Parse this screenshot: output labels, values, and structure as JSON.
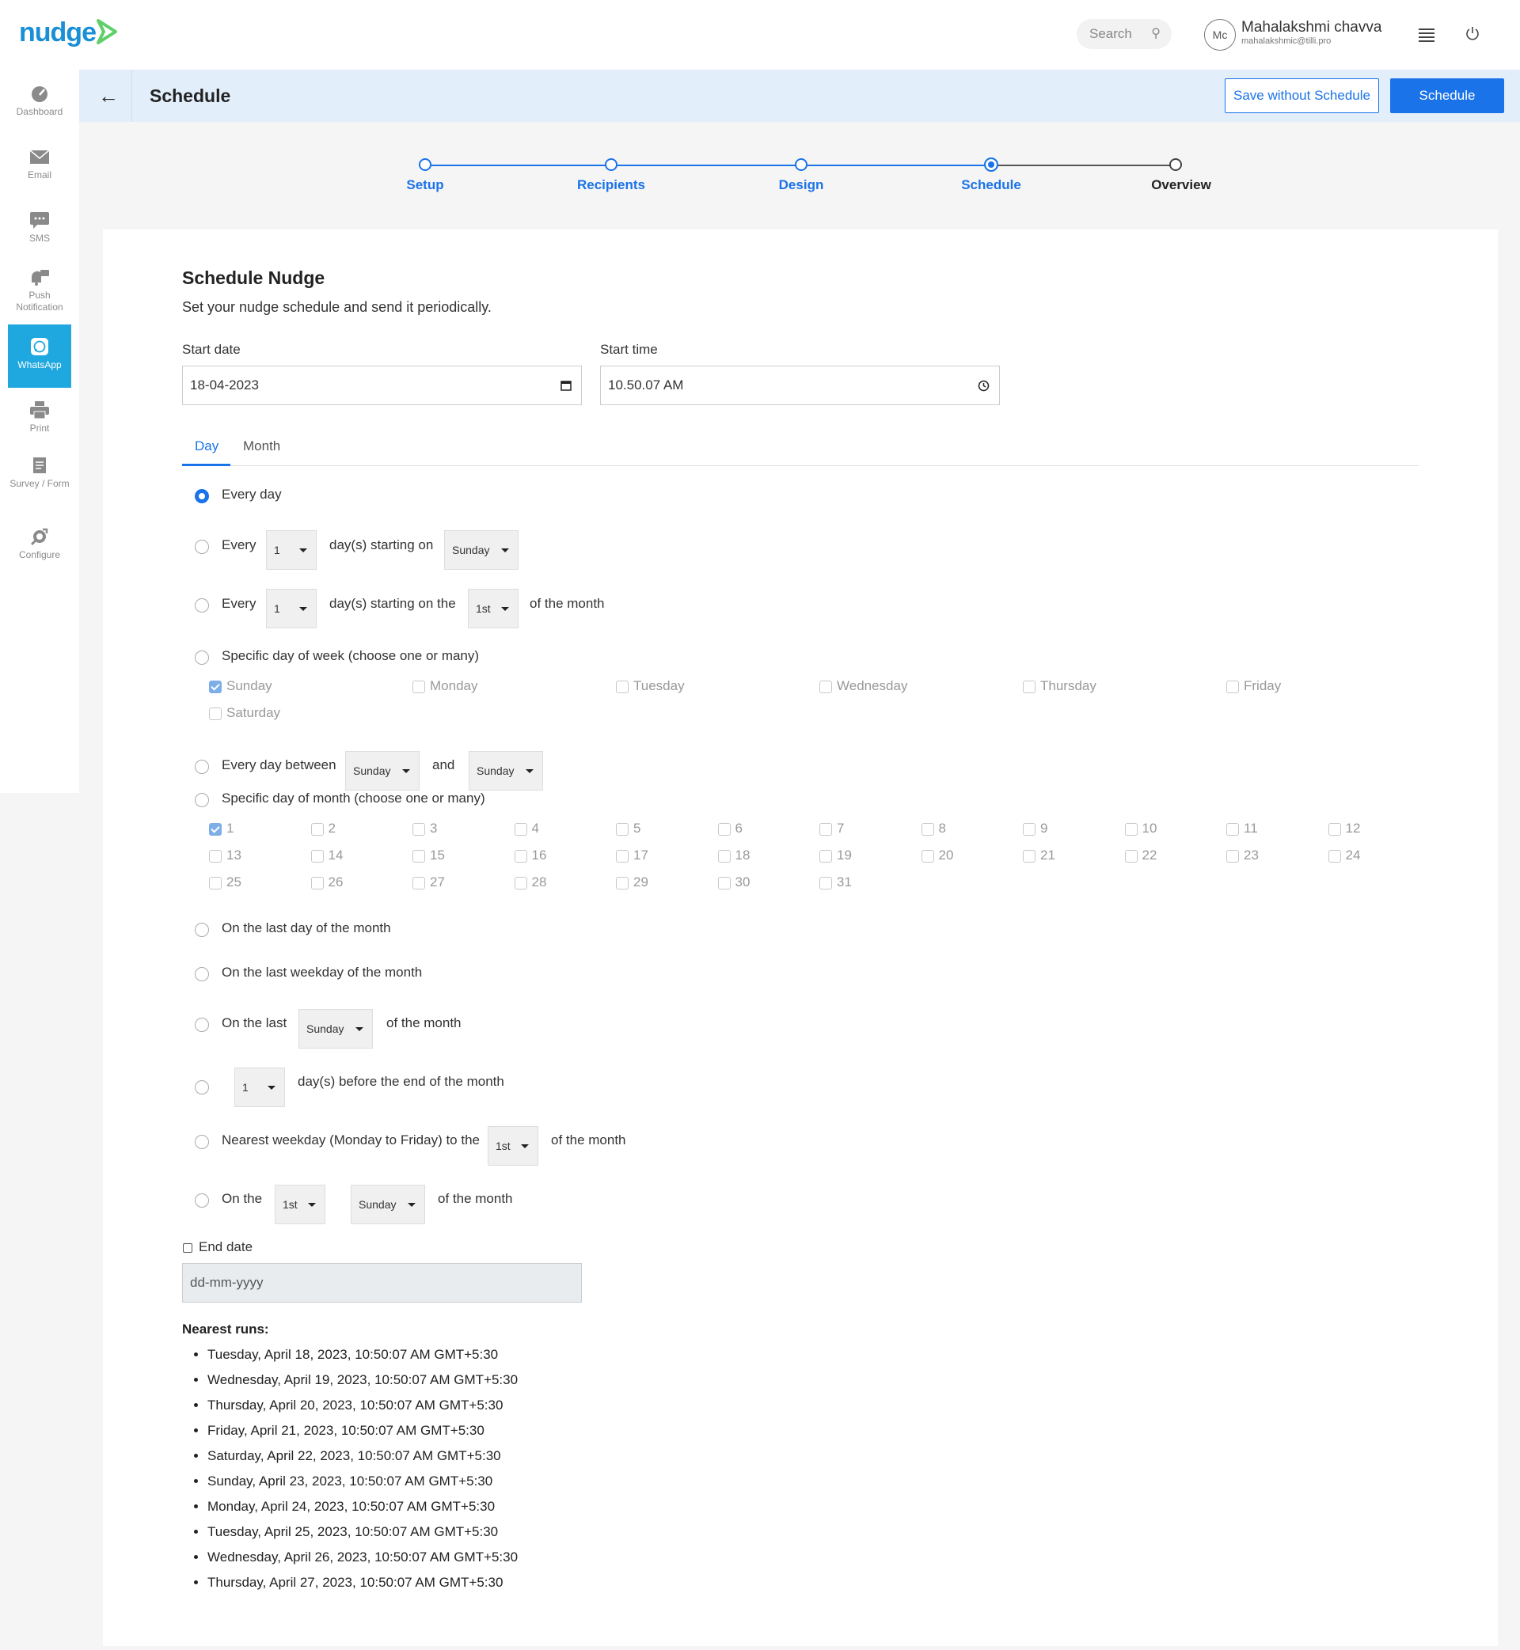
{
  "header": {
    "logo_text": "nudge",
    "search_placeholder": "Search",
    "avatar_initials": "Mc",
    "user_name": "Mahalakshmi chavva",
    "user_email": "mahalakshmic@tilli.pro"
  },
  "sidebar": {
    "items": [
      {
        "label": "Dashboard",
        "icon": "dashboard-icon"
      },
      {
        "label": "Email",
        "icon": "email-icon"
      },
      {
        "label": "SMS",
        "icon": "sms-icon"
      },
      {
        "label": "Push Notification",
        "icon": "push-notification-icon"
      },
      {
        "label": "WhatsApp",
        "icon": "whatsapp-icon",
        "active": true
      },
      {
        "label": "Print",
        "icon": "print-icon"
      },
      {
        "label": "Survey / Form",
        "icon": "survey-icon"
      },
      {
        "label": "Configure",
        "icon": "configure-icon"
      }
    ]
  },
  "page": {
    "title": "Schedule",
    "save_without_schedule_label": "Save without Schedule",
    "schedule_label": "Schedule"
  },
  "stepper": {
    "steps": [
      {
        "label": "Setup",
        "state": "done"
      },
      {
        "label": "Recipients",
        "state": "done"
      },
      {
        "label": "Design",
        "state": "done"
      },
      {
        "label": "Schedule",
        "state": "current"
      },
      {
        "label": "Overview",
        "state": "todo"
      }
    ]
  },
  "form": {
    "title": "Schedule Nudge",
    "subtitle": "Set your nudge schedule and send it periodically.",
    "start_date_label": "Start date",
    "start_date_value": "18-04-2023",
    "start_time_label": "Start time",
    "start_time_value": "10.50.07 AM",
    "tabs": [
      "Day",
      "Month"
    ],
    "active_tab": "Day",
    "options": {
      "every_day": "Every day",
      "every": "Every",
      "every_n_value": "1",
      "days_starting_on": "day(s) starting on",
      "weekday_value": "Sunday",
      "every_m_value": "1",
      "days_starting_on_the": "day(s) starting on the",
      "ordinal_value": "1st",
      "of_the_month": "of the month",
      "specific_day_of_week": "Specific day of week (choose one or many)",
      "weekdays": [
        {
          "label": "Sunday",
          "checked": true
        },
        {
          "label": "Monday",
          "checked": false
        },
        {
          "label": "Tuesday",
          "checked": false
        },
        {
          "label": "Wednesday",
          "checked": false
        },
        {
          "label": "Thursday",
          "checked": false
        },
        {
          "label": "Friday",
          "checked": false
        },
        {
          "label": "Saturday",
          "checked": false
        }
      ],
      "every_day_between": "Every day between",
      "between_from": "Sunday",
      "and": "and",
      "between_to": "Sunday",
      "specific_day_of_month": "Specific day of month (choose one or many)",
      "month_days": [
        "1",
        "2",
        "3",
        "4",
        "5",
        "6",
        "7",
        "8",
        "9",
        "10",
        "11",
        "12",
        "13",
        "14",
        "15",
        "16",
        "17",
        "18",
        "19",
        "20",
        "21",
        "22",
        "23",
        "24",
        "25",
        "26",
        "27",
        "28",
        "29",
        "30",
        "31"
      ],
      "month_day_checked": "1",
      "last_day_of_month": "On the last day of the month",
      "last_weekday_of_month": "On the last weekday of the month",
      "on_the_last": "On the last",
      "on_the_last_value": "Sunday",
      "before_end_value": "1",
      "days_before_end": "day(s) before the end of the month",
      "nearest_weekday": "Nearest weekday (Monday to Friday) to the",
      "nearest_weekday_value": "1st",
      "on_the": "On the",
      "on_the_ordinal": "1st",
      "on_the_weekday": "Sunday"
    },
    "end_date_label": "End date",
    "end_date_placeholder": "dd-mm-yyyy",
    "nearest_runs_title": "Nearest runs:",
    "nearest_runs": [
      "Tuesday, April 18, 2023, 10:50:07 AM GMT+5:30",
      "Wednesday, April 19, 2023, 10:50:07 AM GMT+5:30",
      "Thursday, April 20, 2023, 10:50:07 AM GMT+5:30",
      "Friday, April 21, 2023, 10:50:07 AM GMT+5:30",
      "Saturday, April 22, 2023, 10:50:07 AM GMT+5:30",
      "Sunday, April 23, 2023, 10:50:07 AM GMT+5:30",
      "Monday, April 24, 2023, 10:50:07 AM GMT+5:30",
      "Tuesday, April 25, 2023, 10:50:07 AM GMT+5:30",
      "Wednesday, April 26, 2023, 10:50:07 AM GMT+5:30",
      "Thursday, April 27, 2023, 10:50:07 AM GMT+5:30"
    ]
  },
  "colors": {
    "accent": "#1a73e8",
    "sidebar_active": "#1fa8df",
    "logo": "#1a8fd6",
    "header_band": "#e3eefb"
  }
}
